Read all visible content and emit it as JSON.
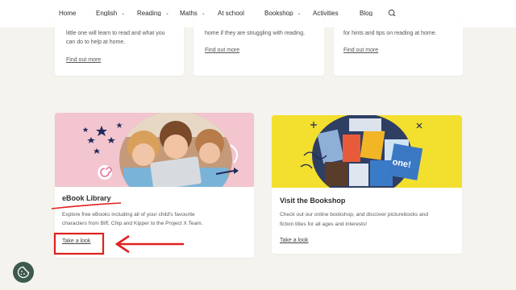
{
  "nav": {
    "items": [
      {
        "label": "Home",
        "dropdown": false
      },
      {
        "label": "English",
        "dropdown": true
      },
      {
        "label": "Reading",
        "dropdown": true
      },
      {
        "label": "Maths",
        "dropdown": true
      },
      {
        "label": "At school",
        "dropdown": false
      },
      {
        "label": "Bookshop",
        "dropdown": true
      },
      {
        "label": "Activities",
        "dropdown": false
      },
      {
        "label": "Blog",
        "dropdown": false
      }
    ],
    "search_icon": "search-icon"
  },
  "top_cards": [
    {
      "line1": "little one will learn to read and what you",
      "line2": "can do to help at home.",
      "link": "Find out more"
    },
    {
      "line1": "home if they are struggling with reading.",
      "link": "Find out more"
    },
    {
      "line1": "for hints and tips on reading at home.",
      "link": "Find out more"
    }
  ],
  "ebook": {
    "title": "eBook Library",
    "desc_line1": "Explore free eBooks including all of your child's favourite",
    "desc_line2": "characters from Biff, Chip and Kipper to the Project X Team.",
    "link": "Take a look"
  },
  "bookshop": {
    "title": "Visit the Bookshop",
    "desc_line1": "Check out our online bookshop, and discover picturebooks and",
    "desc_line2": "fiction titles for all ages and interests!",
    "link": "Take a look"
  },
  "colors": {
    "background": "#f4f3ee",
    "ebook_banner": "#f2c5cf",
    "bookshop_banner": "#f3df2e",
    "annotation_red": "#e02020",
    "cookie_button": "#3d5a4c"
  }
}
